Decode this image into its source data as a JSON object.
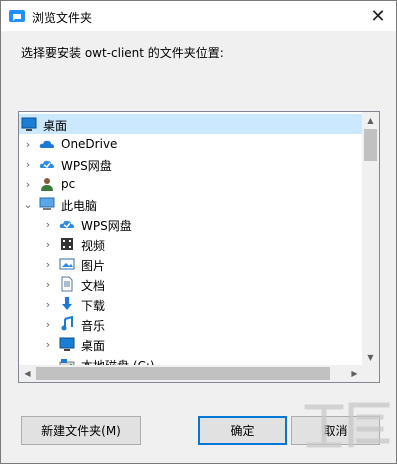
{
  "window": {
    "title": "浏览文件夹",
    "close_glyph": "✕"
  },
  "prompt_text": "选择要安装 owt-client 的文件夹位置:",
  "tree": {
    "items": [
      {
        "label": "桌面",
        "icon": "desktop-icon",
        "level": 0,
        "expander": "",
        "selected": true
      },
      {
        "label": "OneDrive",
        "icon": "onedrive-cloud-icon",
        "level": 1,
        "expander": ">"
      },
      {
        "label": "WPS网盘",
        "icon": "wps-cloud-icon",
        "level": 1,
        "expander": ">"
      },
      {
        "label": "pc",
        "icon": "user-icon",
        "level": 1,
        "expander": ">"
      },
      {
        "label": "此电脑",
        "icon": "computer-icon",
        "level": 1,
        "expander": "v"
      },
      {
        "label": "WPS网盘",
        "icon": "wps-cloud-icon",
        "level": 2,
        "expander": ">"
      },
      {
        "label": "视频",
        "icon": "video-folder-icon",
        "level": 2,
        "expander": ">"
      },
      {
        "label": "图片",
        "icon": "pictures-folder-icon",
        "level": 2,
        "expander": ">"
      },
      {
        "label": "文档",
        "icon": "documents-folder-icon",
        "level": 2,
        "expander": ">"
      },
      {
        "label": "下载",
        "icon": "downloads-folder-icon",
        "level": 2,
        "expander": ">"
      },
      {
        "label": "音乐",
        "icon": "music-folder-icon",
        "level": 2,
        "expander": ">"
      },
      {
        "label": "桌面",
        "icon": "desktop-icon",
        "level": 2,
        "expander": ">"
      },
      {
        "label": "本地磁盘 (C:)",
        "icon": "drive-icon",
        "level": 2,
        "expander": "v"
      }
    ]
  },
  "buttons": {
    "new_folder": "新建文件夹(M)",
    "ok": "确定",
    "cancel": "取消"
  },
  "colors": {
    "selection": "#cce8ff",
    "accent": "#0078d7"
  }
}
